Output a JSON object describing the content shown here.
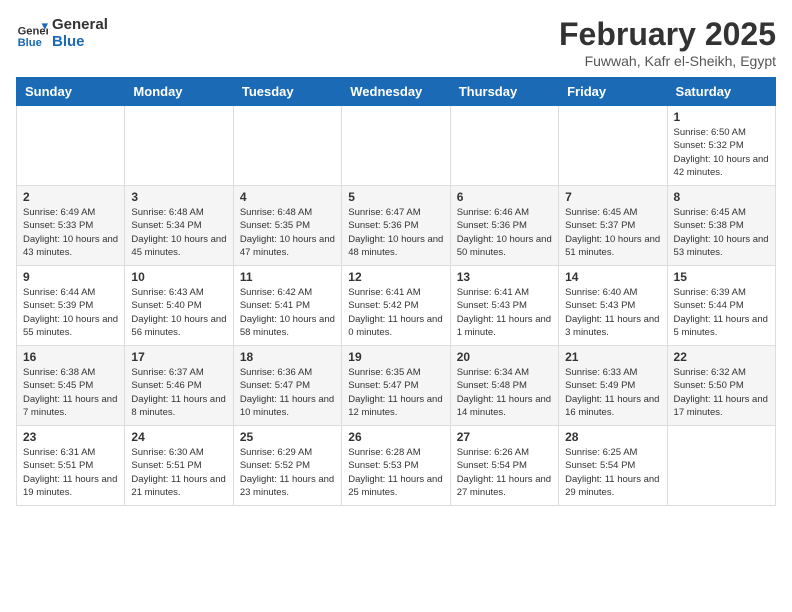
{
  "header": {
    "logo_line1": "General",
    "logo_line2": "Blue",
    "month_title": "February 2025",
    "location": "Fuwwah, Kafr el-Sheikh, Egypt"
  },
  "days_of_week": [
    "Sunday",
    "Monday",
    "Tuesday",
    "Wednesday",
    "Thursday",
    "Friday",
    "Saturday"
  ],
  "weeks": [
    [
      {
        "num": "",
        "info": ""
      },
      {
        "num": "",
        "info": ""
      },
      {
        "num": "",
        "info": ""
      },
      {
        "num": "",
        "info": ""
      },
      {
        "num": "",
        "info": ""
      },
      {
        "num": "",
        "info": ""
      },
      {
        "num": "1",
        "info": "Sunrise: 6:50 AM\nSunset: 5:32 PM\nDaylight: 10 hours and 42 minutes."
      }
    ],
    [
      {
        "num": "2",
        "info": "Sunrise: 6:49 AM\nSunset: 5:33 PM\nDaylight: 10 hours and 43 minutes."
      },
      {
        "num": "3",
        "info": "Sunrise: 6:48 AM\nSunset: 5:34 PM\nDaylight: 10 hours and 45 minutes."
      },
      {
        "num": "4",
        "info": "Sunrise: 6:48 AM\nSunset: 5:35 PM\nDaylight: 10 hours and 47 minutes."
      },
      {
        "num": "5",
        "info": "Sunrise: 6:47 AM\nSunset: 5:36 PM\nDaylight: 10 hours and 48 minutes."
      },
      {
        "num": "6",
        "info": "Sunrise: 6:46 AM\nSunset: 5:36 PM\nDaylight: 10 hours and 50 minutes."
      },
      {
        "num": "7",
        "info": "Sunrise: 6:45 AM\nSunset: 5:37 PM\nDaylight: 10 hours and 51 minutes."
      },
      {
        "num": "8",
        "info": "Sunrise: 6:45 AM\nSunset: 5:38 PM\nDaylight: 10 hours and 53 minutes."
      }
    ],
    [
      {
        "num": "9",
        "info": "Sunrise: 6:44 AM\nSunset: 5:39 PM\nDaylight: 10 hours and 55 minutes."
      },
      {
        "num": "10",
        "info": "Sunrise: 6:43 AM\nSunset: 5:40 PM\nDaylight: 10 hours and 56 minutes."
      },
      {
        "num": "11",
        "info": "Sunrise: 6:42 AM\nSunset: 5:41 PM\nDaylight: 10 hours and 58 minutes."
      },
      {
        "num": "12",
        "info": "Sunrise: 6:41 AM\nSunset: 5:42 PM\nDaylight: 11 hours and 0 minutes."
      },
      {
        "num": "13",
        "info": "Sunrise: 6:41 AM\nSunset: 5:43 PM\nDaylight: 11 hours and 1 minute."
      },
      {
        "num": "14",
        "info": "Sunrise: 6:40 AM\nSunset: 5:43 PM\nDaylight: 11 hours and 3 minutes."
      },
      {
        "num": "15",
        "info": "Sunrise: 6:39 AM\nSunset: 5:44 PM\nDaylight: 11 hours and 5 minutes."
      }
    ],
    [
      {
        "num": "16",
        "info": "Sunrise: 6:38 AM\nSunset: 5:45 PM\nDaylight: 11 hours and 7 minutes."
      },
      {
        "num": "17",
        "info": "Sunrise: 6:37 AM\nSunset: 5:46 PM\nDaylight: 11 hours and 8 minutes."
      },
      {
        "num": "18",
        "info": "Sunrise: 6:36 AM\nSunset: 5:47 PM\nDaylight: 11 hours and 10 minutes."
      },
      {
        "num": "19",
        "info": "Sunrise: 6:35 AM\nSunset: 5:47 PM\nDaylight: 11 hours and 12 minutes."
      },
      {
        "num": "20",
        "info": "Sunrise: 6:34 AM\nSunset: 5:48 PM\nDaylight: 11 hours and 14 minutes."
      },
      {
        "num": "21",
        "info": "Sunrise: 6:33 AM\nSunset: 5:49 PM\nDaylight: 11 hours and 16 minutes."
      },
      {
        "num": "22",
        "info": "Sunrise: 6:32 AM\nSunset: 5:50 PM\nDaylight: 11 hours and 17 minutes."
      }
    ],
    [
      {
        "num": "23",
        "info": "Sunrise: 6:31 AM\nSunset: 5:51 PM\nDaylight: 11 hours and 19 minutes."
      },
      {
        "num": "24",
        "info": "Sunrise: 6:30 AM\nSunset: 5:51 PM\nDaylight: 11 hours and 21 minutes."
      },
      {
        "num": "25",
        "info": "Sunrise: 6:29 AM\nSunset: 5:52 PM\nDaylight: 11 hours and 23 minutes."
      },
      {
        "num": "26",
        "info": "Sunrise: 6:28 AM\nSunset: 5:53 PM\nDaylight: 11 hours and 25 minutes."
      },
      {
        "num": "27",
        "info": "Sunrise: 6:26 AM\nSunset: 5:54 PM\nDaylight: 11 hours and 27 minutes."
      },
      {
        "num": "28",
        "info": "Sunrise: 6:25 AM\nSunset: 5:54 PM\nDaylight: 11 hours and 29 minutes."
      },
      {
        "num": "",
        "info": ""
      }
    ]
  ]
}
